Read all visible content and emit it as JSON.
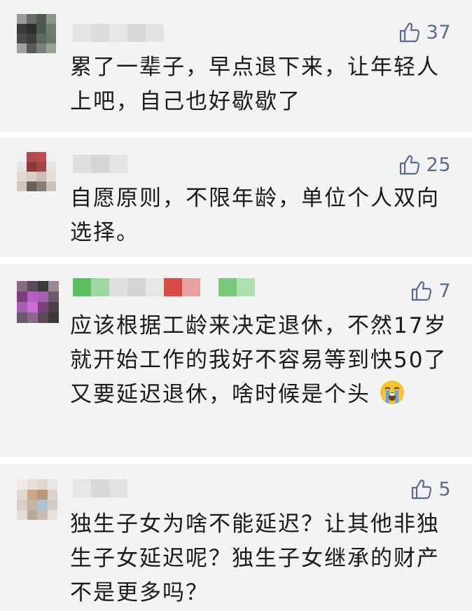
{
  "comments": [
    {
      "likes": "37",
      "text": "累了一辈子，早点退下来，让年轻人上吧，自己也好歇歇了",
      "avatar_colors": [
        "#4a4a4a",
        "#3c3c3c",
        "#5b6a5c",
        "#6f756f"
      ]
    },
    {
      "likes": "25",
      "text": "自愿原则，不限年龄，单位个人双向选择。",
      "avatar_colors": [
        "#c44a4f",
        "#8a3a3a",
        "#d9cfc8",
        "#6a6058"
      ]
    },
    {
      "likes": "7",
      "text": "应该根据工龄来决定退休，不然17岁就开始工作的我好不容易等到快50了又要延迟退休，啥时候是个头",
      "emoji": "loudly-crying-face",
      "avatar_colors": [
        "#7a3d7e",
        "#b75fc4",
        "#3a3a3a",
        "#a85fb0"
      ]
    },
    {
      "likes": "5",
      "text": "独生子女为啥不能延迟？让其他非独生子女延迟呢？独生子女继承的财产不是更多吗？",
      "avatar_colors": [
        "#e8e0d8",
        "#c9a98a",
        "#d8d0c8",
        "#b8a898"
      ]
    }
  ],
  "colors": {
    "card_bg": "#f3f3f3",
    "link_blue": "#576b95",
    "text": "#1a1a1a"
  }
}
